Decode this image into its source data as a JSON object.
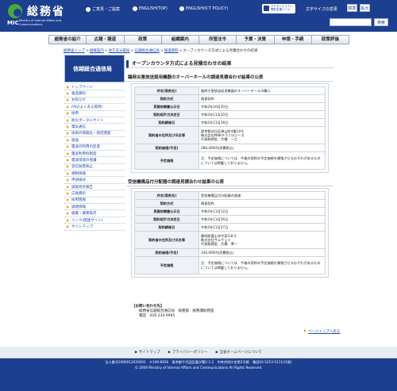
{
  "header": {
    "logo_ja": "総務省",
    "logo_mic": "MIC",
    "logo_en": "Ministry of Internal Affairs and Communications",
    "nav": [
      "ご意見・ご提案",
      "ENGLISH(TOP)",
      "ENGLISH(ICT POLICY)"
    ],
    "accessibility": "アクセシビリティ閲覧支援ツール",
    "font_size_label": "文字サイズの変更",
    "font_size_buttons": [
      "標準",
      "拡大"
    ],
    "search_placeholder": "",
    "search_button": "検索"
  },
  "gnav": [
    "総務省の紹介",
    "広報・報道",
    "政策",
    "組織案内",
    "所管法令",
    "予算・決算",
    "申請・手続",
    "政策評価"
  ],
  "breadcrumb": [
    "総務省トップ",
    "組織案内",
    "地方支分部局",
    "信越総合通信局",
    "報道資料",
    "オープンカウンタ方式による見積合わせの結果"
  ],
  "sidebar": {
    "title": "信越総合通信局",
    "items": [
      "トップページ",
      "報道資料",
      "お知らせ",
      "FAQ(よくある質問)",
      "採用",
      "防災ポータルサイト",
      "電気通信",
      "技術の情報化・研究開発",
      "放送",
      "電波の利用の促進",
      "電波利用料制度",
      "電波環境の保護",
      "混信妨害防止",
      "規制情報",
      "申請様式",
      "調査研究報告",
      "広報資料",
      "採用情報",
      "調達情報",
      "組織・業務案内",
      "リンク(関連サイト)",
      "サイトマップ"
    ]
  },
  "main": {
    "title": "オープンカウンタ方式による見積合わせの結果",
    "sections": [
      {
        "heading": "臨時災害放送局用機器のオーバーホールの調達見積合わせ結果の公表",
        "rows": [
          {
            "k": "件名(契約名)",
            "v": "臨時災害放送局用機器のオーバーホールの購入"
          },
          {
            "k": "契約方式",
            "v": "随意契約"
          },
          {
            "k": "見積依頼書公示日",
            "v": "令和2年10月30日"
          },
          {
            "k": "契約相手方決定日",
            "v": "令和2年11月10日"
          },
          {
            "k": "契約締結日",
            "v": "令和2年11月18日"
          },
          {
            "k": "契約者の住所及び氏名等",
            "v": "東京都渋谷区神山町4番14号\n株式会社NHKテクノロジーズ\n代表取締役　大幡　一三"
          },
          {
            "k": "契約価格(予定)",
            "v": "389,400円(消費税込)"
          },
          {
            "k": "予定価格",
            "v": "注：予定価格については、今後の契約の予定価格を類推させるおそれがあるものについては掲載しておりません。"
          }
        ]
      },
      {
        "heading": "受信機備品付分配器の調達見積合わせ結果の公表",
        "rows": [
          {
            "k": "件名(契約名)",
            "v": "受信機備品付分配器の調達"
          },
          {
            "k": "契約方式",
            "v": "随意契約"
          },
          {
            "k": "見積依頼書公示日",
            "v": "令和2年11月12日"
          },
          {
            "k": "契約相手方決定日",
            "v": "令和2年11月26日"
          },
          {
            "k": "契約締結日",
            "v": "令和2年11月27日"
          },
          {
            "k": "契約者の住所及び氏名等",
            "v": "静岡県富士市今泉3-8-2\n株式会社サムウェイ\n代表取締役　大橋　準一"
          },
          {
            "k": "契約価格(予定)",
            "v": "330,000円(消費税込)"
          },
          {
            "k": "予定価格",
            "v": "注：予定価格については、今後の契約の予定価格を類推させるおそれがあるものについては掲載しておりません。"
          }
        ]
      }
    ]
  },
  "contact": {
    "title": "【お問い合わせ先】",
    "dept": "総務省信越総合通信局　総務部　総務課財務室",
    "tel": "電話　026-234-9985"
  },
  "pagetop": "ページトップへ戻る",
  "footer": {
    "links": [
      "サイトマップ",
      "プライバシーポリシー",
      "当省ホームページについて"
    ],
    "line1": "法人番号2000012020001　〒100-8926　東京都千代田区霞が関2-1-2　中央合同庁舎第2号館　電話03-5253-5111(代表)",
    "line2": "© 2009 Ministry of Internal Affairs and Communications All Rights Reserved."
  }
}
